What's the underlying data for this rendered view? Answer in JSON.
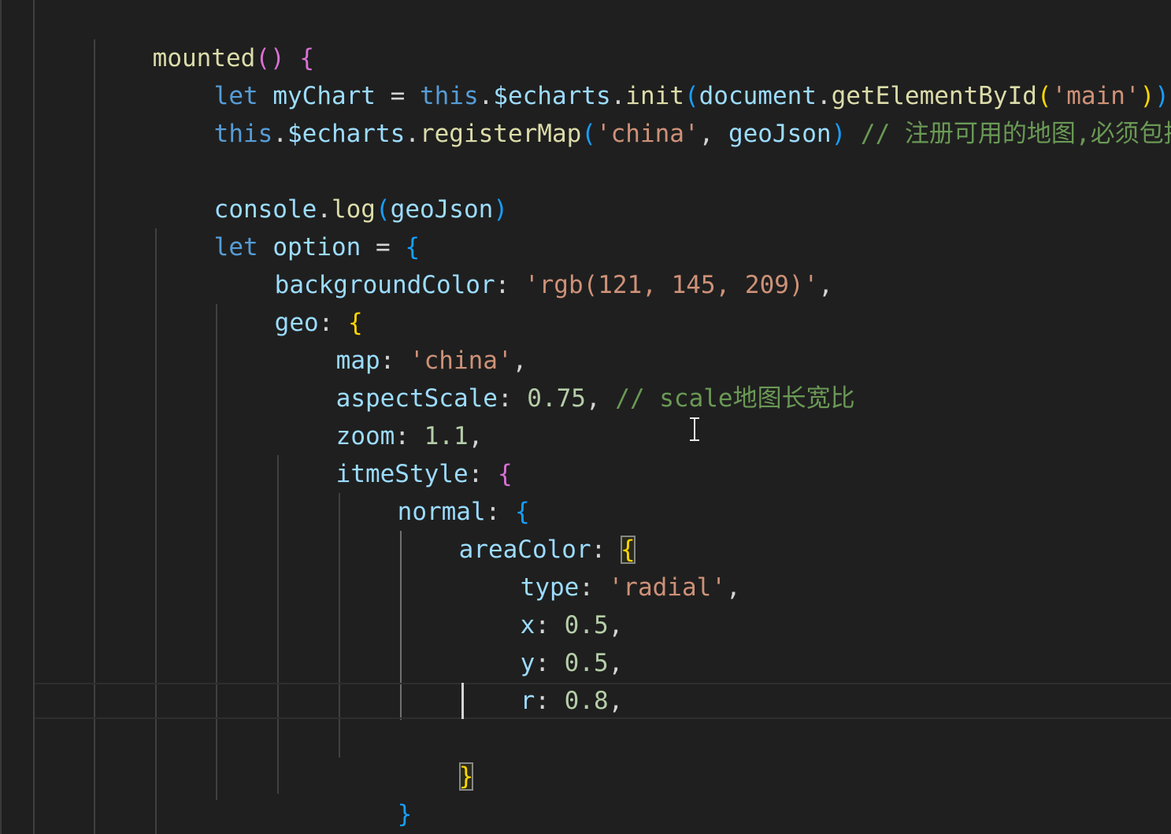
{
  "editor": {
    "language": "javascript",
    "theme_colors": {
      "background": "#1f1f1f",
      "keyword": "#569cd6",
      "function": "#dcdcaa",
      "variable": "#9cdcfe",
      "string": "#ce9178",
      "number": "#b5cea8",
      "comment": "#6a9955",
      "bracket_level1": "#ffd700",
      "bracket_level2": "#da70d6",
      "bracket_level3": "#179fff"
    },
    "lines": [
      {
        "tokens": [
          "mounted",
          "() ",
          "{"
        ]
      },
      {
        "tokens": [
          "let",
          " ",
          "myChart",
          " = ",
          "this",
          ".",
          "$echarts",
          ".",
          "init",
          "(",
          "document",
          ".",
          "getElementById",
          "(",
          "'main'",
          ")",
          ")"
        ]
      },
      {
        "tokens": [
          "this",
          ".",
          "$echarts",
          ".",
          "registerMap",
          "(",
          "'china'",
          ", ",
          "geoJson",
          ") ",
          "// 注册可用的地图,必须包括"
        ]
      },
      {
        "tokens": []
      },
      {
        "tokens": [
          "console",
          ".",
          "log",
          "(",
          "geoJson",
          ")"
        ]
      },
      {
        "tokens": [
          "let",
          " ",
          "option",
          " = ",
          "{"
        ]
      },
      {
        "tokens": [
          "backgroundColor",
          ": ",
          "'rgb(121, 145, 209)'",
          ","
        ]
      },
      {
        "tokens": [
          "geo",
          ": ",
          "{"
        ]
      },
      {
        "tokens": [
          "map",
          ": ",
          "'china'",
          ","
        ]
      },
      {
        "tokens": [
          "aspectScale",
          ": ",
          "0.75",
          ", ",
          "// scale地图长宽比"
        ]
      },
      {
        "tokens": [
          "zoom",
          ": ",
          "1.1",
          ","
        ]
      },
      {
        "tokens": [
          "itmeStyle",
          ": ",
          "{"
        ]
      },
      {
        "tokens": [
          "normal",
          ": ",
          "{"
        ]
      },
      {
        "tokens": [
          "areaColor",
          ": ",
          "{"
        ]
      },
      {
        "tokens": [
          "type",
          ": ",
          "'radial'",
          ","
        ]
      },
      {
        "tokens": [
          "x",
          ": ",
          "0.5",
          ","
        ]
      },
      {
        "tokens": [
          "y",
          ": ",
          "0.5",
          ","
        ]
      },
      {
        "tokens": [
          "r",
          ": ",
          "0.8",
          ","
        ]
      },
      {
        "tokens": []
      },
      {
        "tokens": [
          "}"
        ]
      },
      {
        "tokens": [
          "}"
        ]
      },
      {
        "tokens": [
          "}",
          ","
        ]
      }
    ]
  }
}
